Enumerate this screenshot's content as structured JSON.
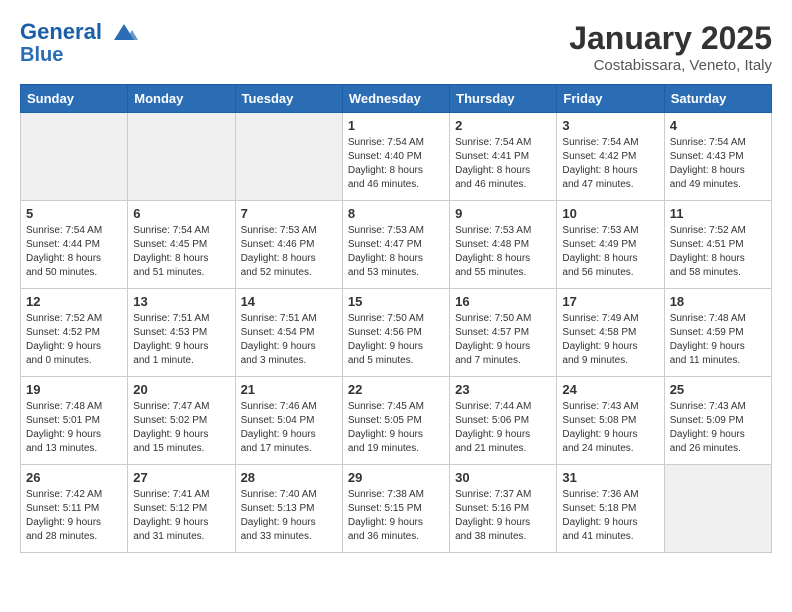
{
  "header": {
    "logo_line1": "General",
    "logo_line2": "Blue",
    "title": "January 2025",
    "subtitle": "Costabissara, Veneto, Italy"
  },
  "weekdays": [
    "Sunday",
    "Monday",
    "Tuesday",
    "Wednesday",
    "Thursday",
    "Friday",
    "Saturday"
  ],
  "weeks": [
    [
      {
        "day": "",
        "info": ""
      },
      {
        "day": "",
        "info": ""
      },
      {
        "day": "",
        "info": ""
      },
      {
        "day": "1",
        "info": "Sunrise: 7:54 AM\nSunset: 4:40 PM\nDaylight: 8 hours\nand 46 minutes."
      },
      {
        "day": "2",
        "info": "Sunrise: 7:54 AM\nSunset: 4:41 PM\nDaylight: 8 hours\nand 46 minutes."
      },
      {
        "day": "3",
        "info": "Sunrise: 7:54 AM\nSunset: 4:42 PM\nDaylight: 8 hours\nand 47 minutes."
      },
      {
        "day": "4",
        "info": "Sunrise: 7:54 AM\nSunset: 4:43 PM\nDaylight: 8 hours\nand 49 minutes."
      }
    ],
    [
      {
        "day": "5",
        "info": "Sunrise: 7:54 AM\nSunset: 4:44 PM\nDaylight: 8 hours\nand 50 minutes."
      },
      {
        "day": "6",
        "info": "Sunrise: 7:54 AM\nSunset: 4:45 PM\nDaylight: 8 hours\nand 51 minutes."
      },
      {
        "day": "7",
        "info": "Sunrise: 7:53 AM\nSunset: 4:46 PM\nDaylight: 8 hours\nand 52 minutes."
      },
      {
        "day": "8",
        "info": "Sunrise: 7:53 AM\nSunset: 4:47 PM\nDaylight: 8 hours\nand 53 minutes."
      },
      {
        "day": "9",
        "info": "Sunrise: 7:53 AM\nSunset: 4:48 PM\nDaylight: 8 hours\nand 55 minutes."
      },
      {
        "day": "10",
        "info": "Sunrise: 7:53 AM\nSunset: 4:49 PM\nDaylight: 8 hours\nand 56 minutes."
      },
      {
        "day": "11",
        "info": "Sunrise: 7:52 AM\nSunset: 4:51 PM\nDaylight: 8 hours\nand 58 minutes."
      }
    ],
    [
      {
        "day": "12",
        "info": "Sunrise: 7:52 AM\nSunset: 4:52 PM\nDaylight: 9 hours\nand 0 minutes."
      },
      {
        "day": "13",
        "info": "Sunrise: 7:51 AM\nSunset: 4:53 PM\nDaylight: 9 hours\nand 1 minute."
      },
      {
        "day": "14",
        "info": "Sunrise: 7:51 AM\nSunset: 4:54 PM\nDaylight: 9 hours\nand 3 minutes."
      },
      {
        "day": "15",
        "info": "Sunrise: 7:50 AM\nSunset: 4:56 PM\nDaylight: 9 hours\nand 5 minutes."
      },
      {
        "day": "16",
        "info": "Sunrise: 7:50 AM\nSunset: 4:57 PM\nDaylight: 9 hours\nand 7 minutes."
      },
      {
        "day": "17",
        "info": "Sunrise: 7:49 AM\nSunset: 4:58 PM\nDaylight: 9 hours\nand 9 minutes."
      },
      {
        "day": "18",
        "info": "Sunrise: 7:48 AM\nSunset: 4:59 PM\nDaylight: 9 hours\nand 11 minutes."
      }
    ],
    [
      {
        "day": "19",
        "info": "Sunrise: 7:48 AM\nSunset: 5:01 PM\nDaylight: 9 hours\nand 13 minutes."
      },
      {
        "day": "20",
        "info": "Sunrise: 7:47 AM\nSunset: 5:02 PM\nDaylight: 9 hours\nand 15 minutes."
      },
      {
        "day": "21",
        "info": "Sunrise: 7:46 AM\nSunset: 5:04 PM\nDaylight: 9 hours\nand 17 minutes."
      },
      {
        "day": "22",
        "info": "Sunrise: 7:45 AM\nSunset: 5:05 PM\nDaylight: 9 hours\nand 19 minutes."
      },
      {
        "day": "23",
        "info": "Sunrise: 7:44 AM\nSunset: 5:06 PM\nDaylight: 9 hours\nand 21 minutes."
      },
      {
        "day": "24",
        "info": "Sunrise: 7:43 AM\nSunset: 5:08 PM\nDaylight: 9 hours\nand 24 minutes."
      },
      {
        "day": "25",
        "info": "Sunrise: 7:43 AM\nSunset: 5:09 PM\nDaylight: 9 hours\nand 26 minutes."
      }
    ],
    [
      {
        "day": "26",
        "info": "Sunrise: 7:42 AM\nSunset: 5:11 PM\nDaylight: 9 hours\nand 28 minutes."
      },
      {
        "day": "27",
        "info": "Sunrise: 7:41 AM\nSunset: 5:12 PM\nDaylight: 9 hours\nand 31 minutes."
      },
      {
        "day": "28",
        "info": "Sunrise: 7:40 AM\nSunset: 5:13 PM\nDaylight: 9 hours\nand 33 minutes."
      },
      {
        "day": "29",
        "info": "Sunrise: 7:38 AM\nSunset: 5:15 PM\nDaylight: 9 hours\nand 36 minutes."
      },
      {
        "day": "30",
        "info": "Sunrise: 7:37 AM\nSunset: 5:16 PM\nDaylight: 9 hours\nand 38 minutes."
      },
      {
        "day": "31",
        "info": "Sunrise: 7:36 AM\nSunset: 5:18 PM\nDaylight: 9 hours\nand 41 minutes."
      },
      {
        "day": "",
        "info": ""
      }
    ]
  ]
}
